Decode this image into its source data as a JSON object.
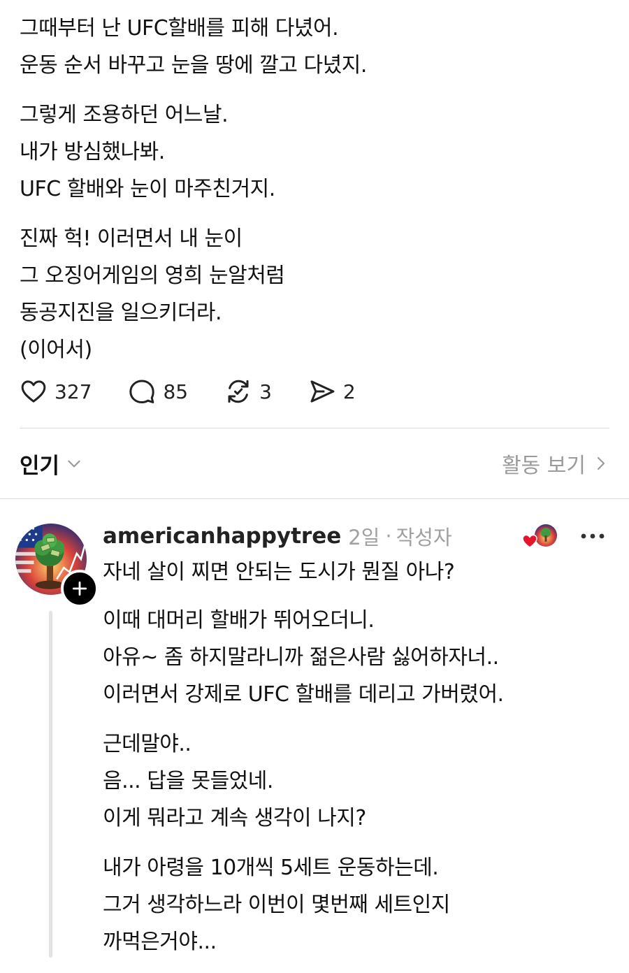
{
  "post": {
    "paragraphs": [
      [
        "그때부터 난 UFC할배를 피해 다녔어.",
        "운동 순서 바꾸고 눈을 땅에 깔고 다녔지."
      ],
      [
        "그렇게 조용하던 어느날.",
        "내가 방심했나봐.",
        "UFC 할배와 눈이 마주친거지."
      ],
      [
        "진짜 헉! 이러면서 내 눈이",
        "그 오징어게임의 영희 눈알처럼",
        "동공지진을 일으키더라.",
        "(이어서)"
      ]
    ]
  },
  "actions": {
    "like_count": "327",
    "comment_count": "85",
    "repost_count": "3",
    "share_count": "2",
    "icons": [
      "heart-icon",
      "comment-icon",
      "repost-icon",
      "send-icon"
    ]
  },
  "sort": {
    "label": "인기",
    "activity_label": "활동 보기"
  },
  "reply": {
    "username": "americanhappytree",
    "time": "2일",
    "separator": "·",
    "author_tag": "작성자",
    "first_line": "자네 살이 찌면 안되는 도시가 뭔질 아나?",
    "paragraphs": [
      [
        "이때 대머리 할배가 뛰어오더니.",
        "아유~ 좀 하지말라니까 젊은사람 싫어하자너..",
        "이러면서 강제로 UFC 할배를 데리고 가버렸어."
      ],
      [
        "근데말야..",
        "음... 답을 못들었네.",
        "이게 뭐라고 계속 생각이 나지?"
      ],
      [
        "내가 아령을 10개씩 5세트 운동하는데.",
        "그거 생각하느라 이번이 몇번째 세트인지",
        "까먹은거야..."
      ]
    ]
  },
  "colors": {
    "text": "#111111",
    "muted": "#9a9a9a",
    "divider": "#dcdcdc",
    "heart_red": "#e8142b"
  }
}
